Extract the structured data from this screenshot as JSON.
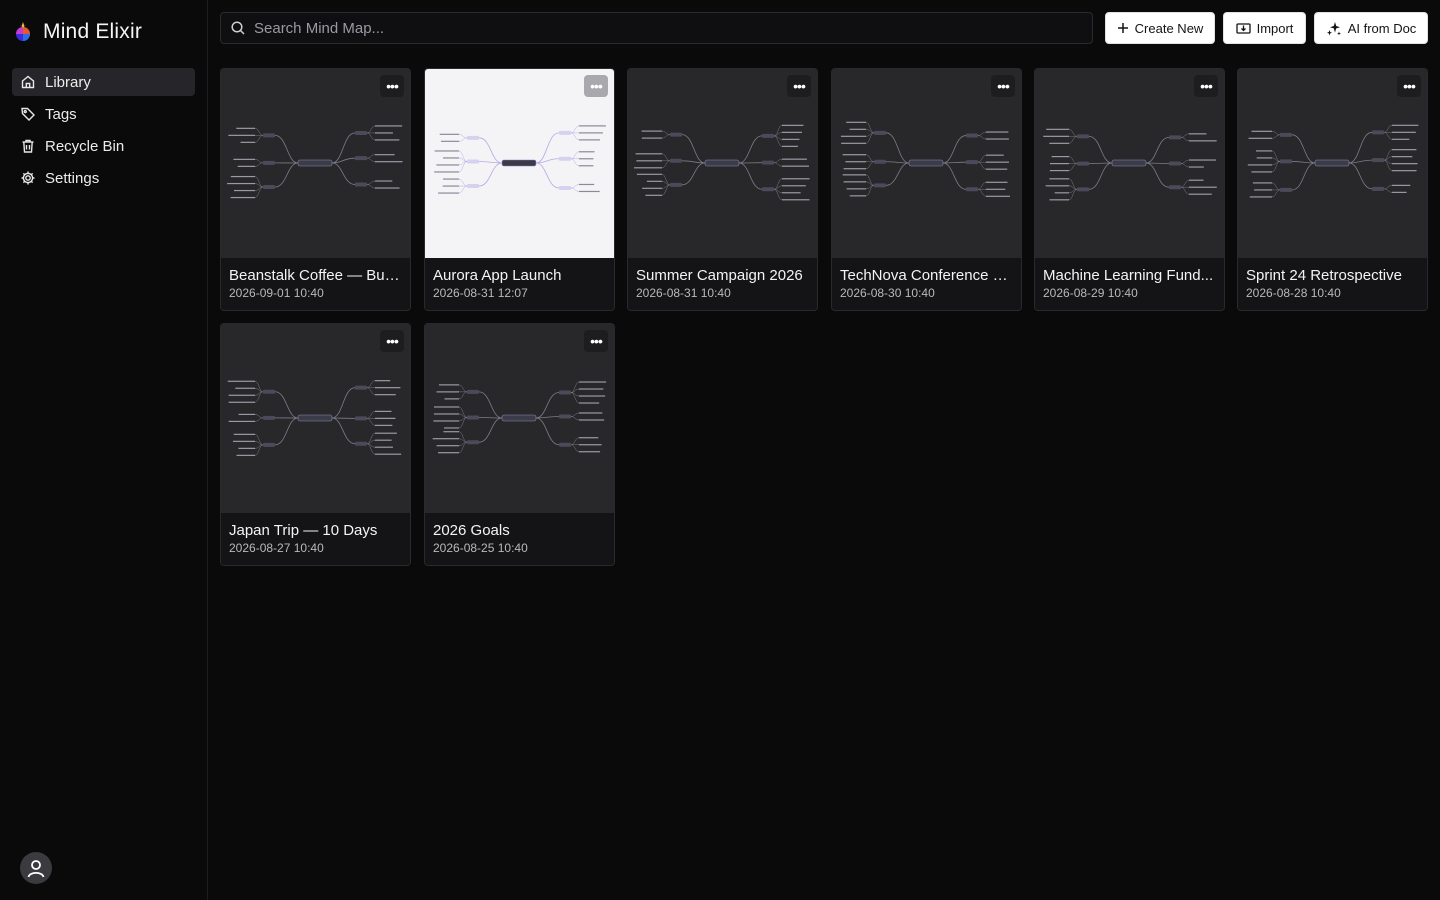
{
  "app": {
    "name": "Mind Elixir"
  },
  "sidebar": {
    "items": [
      {
        "label": "Library",
        "icon": "home-icon",
        "active": true
      },
      {
        "label": "Tags",
        "icon": "tag-icon",
        "active": false
      },
      {
        "label": "Recycle Bin",
        "icon": "trash-icon",
        "active": false
      },
      {
        "label": "Settings",
        "icon": "gear-icon",
        "active": false
      }
    ]
  },
  "toolbar": {
    "search_placeholder": "Search Mind Map...",
    "create_label": "Create New",
    "import_label": "Import",
    "ai_label": "AI from Doc"
  },
  "maps": [
    {
      "title": "Beanstalk Coffee — Bus...",
      "date": "2026-09-01 10:40",
      "theme": "dark"
    },
    {
      "title": "Aurora App Launch",
      "date": "2026-08-31 12:07",
      "theme": "light"
    },
    {
      "title": "Summer Campaign 2026",
      "date": "2026-08-31 10:40",
      "theme": "dark"
    },
    {
      "title": "TechNova Conference 2...",
      "date": "2026-08-30 10:40",
      "theme": "dark"
    },
    {
      "title": "Machine Learning Fund...",
      "date": "2026-08-29 10:40",
      "theme": "dark"
    },
    {
      "title": "Sprint 24 Retrospective",
      "date": "2026-08-28 10:40",
      "theme": "dark"
    },
    {
      "title": "Japan Trip — 10 Days",
      "date": "2026-08-27 10:40",
      "theme": "dark"
    },
    {
      "title": "2026 Goals",
      "date": "2026-08-25 10:40",
      "theme": "dark"
    }
  ],
  "colors": {
    "background": "#0a0a0b",
    "card_dark": "#28282b",
    "card_light": "#f4f4f6",
    "active_nav": "#26262a"
  }
}
